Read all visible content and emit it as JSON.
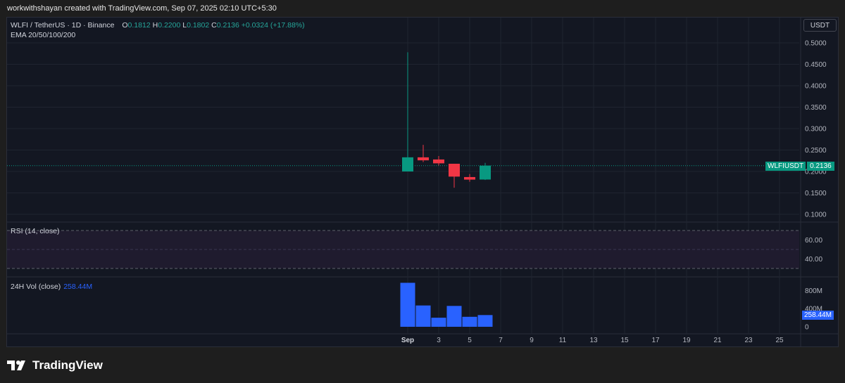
{
  "header": {
    "credit": "workwithshayan created with TradingView.com, Sep 07, 2025 02:10 UTC+5:30"
  },
  "legend": {
    "symbol": "WLFI / TetherUS · 1D · Binance",
    "o_label": "O",
    "o_value": "0.1812",
    "h_label": "H",
    "h_value": "0.2200",
    "l_label": "L",
    "l_value": "0.1802",
    "c_label": "C",
    "c_value": "0.2136",
    "change": "+0.0324 (+17.88%)",
    "ema": "EMA 20/50/100/200"
  },
  "currency_button": "USDT",
  "price_tag": {
    "symbol": "WLFIUSDT",
    "value": "0.2136"
  },
  "rsi": {
    "title": "RSI (14, close)"
  },
  "volume": {
    "title": "24H Vol (close)",
    "value": "258.44M"
  },
  "brand": {
    "name": "TradingView"
  },
  "colors": {
    "up": "#089981",
    "down": "#f23645",
    "volume": "#2962ff",
    "background": "#131722"
  },
  "chart_data": [
    {
      "type": "candlestick",
      "title": "WLFI / TetherUS · 1D · Binance",
      "x_labels": [
        "Sep",
        "3",
        "5",
        "7",
        "9",
        "11",
        "13",
        "15",
        "17",
        "19",
        "21",
        "23",
        "25"
      ],
      "y_ticks": [
        "0.5000",
        "0.4500",
        "0.4000",
        "0.3500",
        "0.3000",
        "0.2500",
        "0.2000",
        "0.1500",
        "0.1000"
      ],
      "ylim": [
        0.08,
        0.52
      ],
      "candles": [
        {
          "date": "Sep 1",
          "open": 0.2,
          "high": 0.478,
          "low": 0.2,
          "close": 0.233
        },
        {
          "date": "Sep 2",
          "open": 0.233,
          "high": 0.262,
          "low": 0.222,
          "close": 0.226
        },
        {
          "date": "Sep 3",
          "open": 0.228,
          "high": 0.236,
          "low": 0.214,
          "close": 0.219
        },
        {
          "date": "Sep 4",
          "open": 0.218,
          "high": 0.218,
          "low": 0.162,
          "close": 0.188
        },
        {
          "date": "Sep 5",
          "open": 0.187,
          "high": 0.194,
          "low": 0.176,
          "close": 0.181
        },
        {
          "date": "Sep 6",
          "open": 0.1812,
          "high": 0.22,
          "low": 0.1802,
          "close": 0.2136
        }
      ],
      "last_price": 0.2136
    },
    {
      "type": "line",
      "title": "RSI (14, close)",
      "y_ticks": [
        "60.00",
        "40.00"
      ],
      "bands": [
        30,
        70
      ],
      "ylim": [
        27,
        73
      ]
    },
    {
      "type": "bar",
      "title": "24H Vol (close)",
      "y_ticks": [
        "800M",
        "400M",
        "0"
      ],
      "ylim": [
        0,
        1000
      ],
      "values": [
        970,
        470,
        200,
        460,
        220,
        258.44
      ],
      "last_value": "258.44M"
    }
  ]
}
